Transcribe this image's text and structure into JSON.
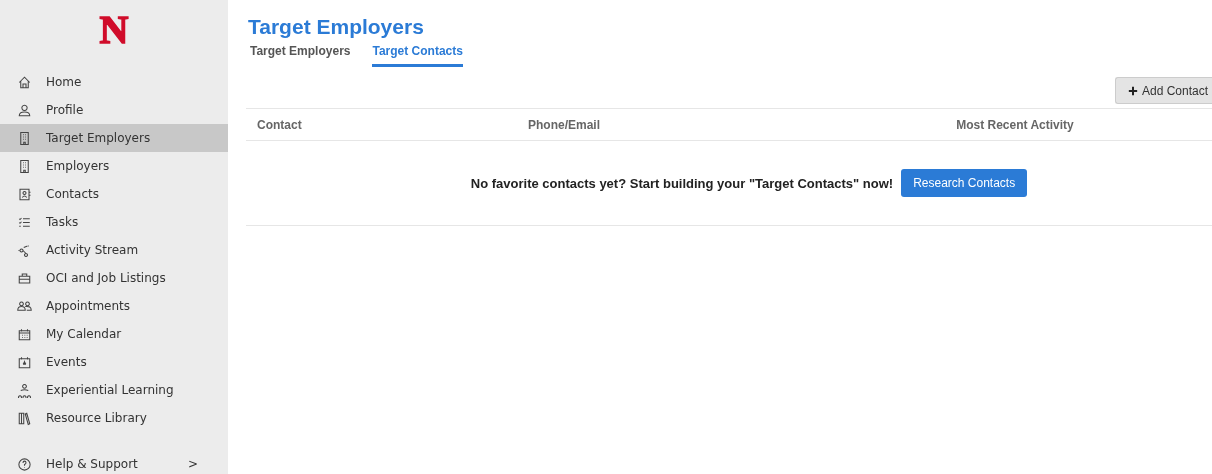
{
  "logo": "N",
  "sidebar": {
    "items": [
      {
        "label": "Home",
        "selected": false
      },
      {
        "label": "Profile",
        "selected": false
      },
      {
        "label": "Target Employers",
        "selected": true
      },
      {
        "label": "Employers",
        "selected": false
      },
      {
        "label": "Contacts",
        "selected": false
      },
      {
        "label": "Tasks",
        "selected": false
      },
      {
        "label": "Activity Stream",
        "selected": false
      },
      {
        "label": "OCI and Job Listings",
        "selected": false
      },
      {
        "label": "Appointments",
        "selected": false
      },
      {
        "label": "My Calendar",
        "selected": false
      },
      {
        "label": "Events",
        "selected": false
      },
      {
        "label": "Experiential Learning",
        "selected": false
      },
      {
        "label": "Resource Library",
        "selected": false
      }
    ],
    "help": {
      "label": "Help & Support",
      "chevron": ">"
    }
  },
  "page": {
    "title": "Target Employers",
    "tabs": [
      {
        "label": "Target Employers",
        "selected": false
      },
      {
        "label": "Target Contacts",
        "selected": true
      }
    ],
    "add_button": "Add Contact",
    "table": {
      "columns": [
        "Contact",
        "Phone/Email",
        "Most Recent Activity"
      ],
      "empty_message": "No favorite contacts yet? Start building your \"Target Contacts\" now!",
      "empty_button": "Research Contacts"
    }
  }
}
